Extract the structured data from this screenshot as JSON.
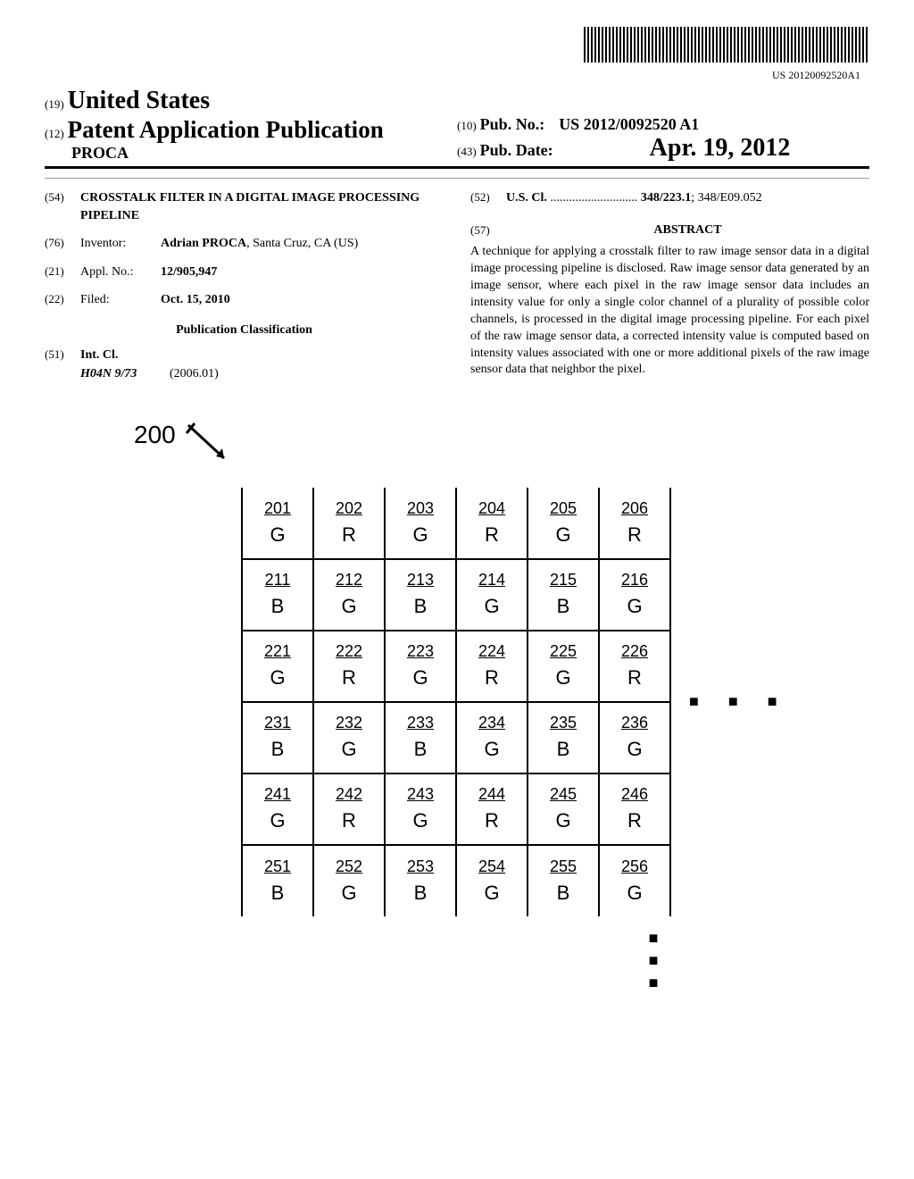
{
  "barcode_id": "US 20120092520A1",
  "header": {
    "country_prefix": "(19)",
    "country": "United States",
    "pub_type_prefix": "(12)",
    "pub_type": "Patent Application Publication",
    "inventor_surname": "PROCA",
    "pub_no_prefix": "(10)",
    "pub_no_label": "Pub. No.:",
    "pub_no": "US 2012/0092520 A1",
    "pub_date_prefix": "(43)",
    "pub_date_label": "Pub. Date:",
    "pub_date": "Apr. 19, 2012"
  },
  "biblio": {
    "title_code": "(54)",
    "title": "CROSSTALK FILTER IN A DIGITAL IMAGE PROCESSING PIPELINE",
    "inventor_code": "(76)",
    "inventor_label": "Inventor:",
    "inventor_value": "Adrian PROCA",
    "inventor_loc": ", Santa Cruz, CA (US)",
    "appl_code": "(21)",
    "appl_label": "Appl. No.:",
    "appl_value": "12/905,947",
    "filed_code": "(22)",
    "filed_label": "Filed:",
    "filed_value": "Oct. 15, 2010",
    "classification_header": "Publication Classification",
    "intcl_code": "(51)",
    "intcl_label": "Int. Cl.",
    "intcl_value": "H04N 9/73",
    "intcl_edition": "(2006.01)",
    "uscl_code": "(52)",
    "uscl_label": "U.S. Cl.",
    "uscl_dots": " ............................ ",
    "uscl_value_bold": "348/223.1",
    "uscl_value_rest": "; 348/E09.052",
    "abstract_code": "(57)",
    "abstract_header": "ABSTRACT",
    "abstract_text": "A technique for applying a crosstalk filter to raw image sensor data in a digital image processing pipeline is disclosed. Raw image sensor data generated by an image sensor, where each pixel in the raw image sensor data includes an intensity value for only a single color channel of a plurality of possible color channels, is processed in the digital image processing pipeline. For each pixel of the raw image sensor data, a corrected intensity value is computed based on intensity values associated with one or more additional pixels of the raw image sensor data that neighbor the pixel."
  },
  "figure": {
    "ref": "200",
    "grid": [
      [
        {
          "id": "201",
          "c": "G"
        },
        {
          "id": "202",
          "c": "R"
        },
        {
          "id": "203",
          "c": "G"
        },
        {
          "id": "204",
          "c": "R"
        },
        {
          "id": "205",
          "c": "G"
        },
        {
          "id": "206",
          "c": "R"
        }
      ],
      [
        {
          "id": "211",
          "c": "B"
        },
        {
          "id": "212",
          "c": "G"
        },
        {
          "id": "213",
          "c": "B"
        },
        {
          "id": "214",
          "c": "G"
        },
        {
          "id": "215",
          "c": "B"
        },
        {
          "id": "216",
          "c": "G"
        }
      ],
      [
        {
          "id": "221",
          "c": "G"
        },
        {
          "id": "222",
          "c": "R"
        },
        {
          "id": "223",
          "c": "G"
        },
        {
          "id": "224",
          "c": "R"
        },
        {
          "id": "225",
          "c": "G"
        },
        {
          "id": "226",
          "c": "R"
        }
      ],
      [
        {
          "id": "231",
          "c": "B"
        },
        {
          "id": "232",
          "c": "G"
        },
        {
          "id": "233",
          "c": "B"
        },
        {
          "id": "234",
          "c": "G"
        },
        {
          "id": "235",
          "c": "B"
        },
        {
          "id": "236",
          "c": "G"
        }
      ],
      [
        {
          "id": "241",
          "c": "G"
        },
        {
          "id": "242",
          "c": "R"
        },
        {
          "id": "243",
          "c": "G"
        },
        {
          "id": "244",
          "c": "R"
        },
        {
          "id": "245",
          "c": "G"
        },
        {
          "id": "246",
          "c": "R"
        }
      ],
      [
        {
          "id": "251",
          "c": "B"
        },
        {
          "id": "252",
          "c": "G"
        },
        {
          "id": "253",
          "c": "B"
        },
        {
          "id": "254",
          "c": "G"
        },
        {
          "id": "255",
          "c": "B"
        },
        {
          "id": "256",
          "c": "G"
        }
      ]
    ],
    "dots": "■ ■ ■",
    "dots_v1": "■",
    "dots_v2": "■",
    "dots_v3": "■"
  }
}
